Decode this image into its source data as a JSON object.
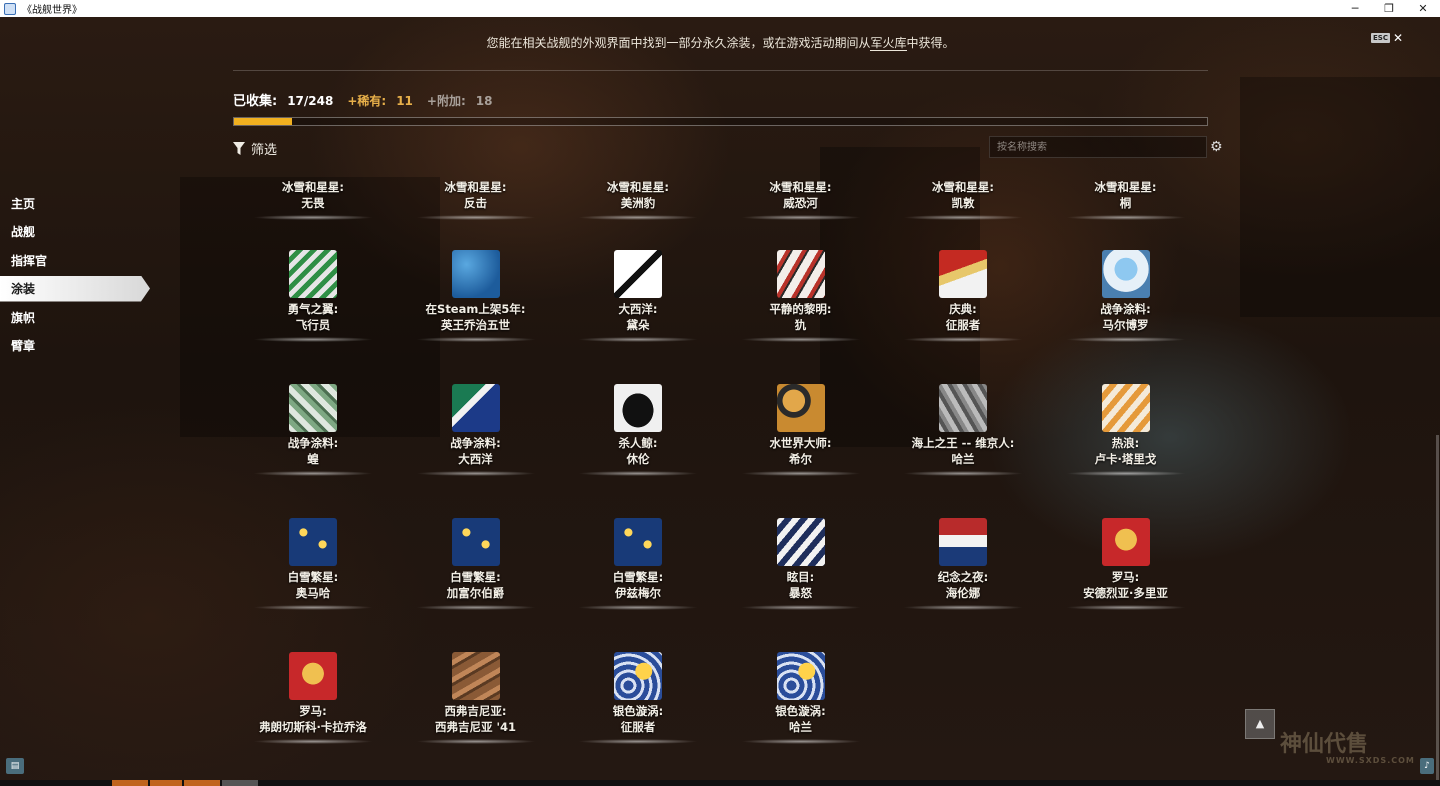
{
  "window": {
    "title": "《战舰世界》",
    "controls": [
      "─",
      "❐",
      "✕"
    ]
  },
  "notice": {
    "before": "您能在相关战舰的外观界面中找到一部分永久涂装，或在游戏活动期间从",
    "link": "军火库",
    "after": "中获得。"
  },
  "esc": {
    "key": "ESC",
    "close": "✕"
  },
  "stats": {
    "collected_label": "已收集:",
    "collected_value": "17/248",
    "rare_label": "+稀有:",
    "rare_value": "11",
    "extra_label": "+附加:",
    "extra_value": "18",
    "progress_fraction": 0.06
  },
  "filter": {
    "label": "筛选"
  },
  "search": {
    "placeholder": "按名称搜索"
  },
  "sidebar": {
    "items": [
      {
        "label": "主页",
        "active": false
      },
      {
        "label": "战舰",
        "active": false
      },
      {
        "label": "指挥官",
        "active": false
      },
      {
        "label": "涂装",
        "active": true
      },
      {
        "label": "旗帜",
        "active": false
      },
      {
        "label": "臂章",
        "active": false
      }
    ]
  },
  "cards": [
    {
      "line1": "冰雪和星星:",
      "line2": "无畏",
      "icon": "none"
    },
    {
      "line1": "冰雪和星星:",
      "line2": "反击",
      "icon": "none"
    },
    {
      "line1": "冰雪和星星:",
      "line2": "美洲豹",
      "icon": "none"
    },
    {
      "line1": "冰雪和星星:",
      "line2": "威恐河",
      "icon": "none"
    },
    {
      "line1": "冰雪和星星:",
      "line2": "凯敦",
      "icon": "none"
    },
    {
      "line1": "冰雪和星星:",
      "line2": "桐",
      "icon": "none"
    },
    {
      "line1": "勇气之翼:",
      "line2": "飞行员",
      "icon": "green-white-stripes-icon"
    },
    {
      "line1": "在Steam上架5年:",
      "line2": "英王乔治五世",
      "icon": "blue-pattern-icon"
    },
    {
      "line1": "大西洋:",
      "line2": "黛朵",
      "icon": "black-white-wing-icon"
    },
    {
      "line1": "平静的黎明:",
      "line2": "犰",
      "icon": "red-white-diagonal-icon"
    },
    {
      "line1": "庆典:",
      "line2": "征服者",
      "icon": "red-gold-icon"
    },
    {
      "line1": "战争涂料:",
      "line2": "马尔博罗",
      "icon": "blue-medal-icon"
    },
    {
      "line1": "战争涂料:",
      "line2": "蝗",
      "icon": "green-camo-icon"
    },
    {
      "line1": "战争涂料:",
      "line2": "大西洋",
      "icon": "blue-green-camo-icon"
    },
    {
      "line1": "杀人鲸:",
      "line2": "休伦",
      "icon": "orca-icon"
    },
    {
      "line1": "水世界大师:",
      "line2": "希尔",
      "icon": "amber-camo-icon"
    },
    {
      "line1": "海上之王 -- 维京人:",
      "line2": "哈兰",
      "icon": "gray-viking-icon"
    },
    {
      "line1": "热浪:",
      "line2": "卢卡·塔里戈",
      "icon": "orange-white-icon"
    },
    {
      "line1": "白雪繁星:",
      "line2": "奥马哈",
      "icon": "navy-star-icon"
    },
    {
      "line1": "白雪繁星:",
      "line2": "加富尔伯爵",
      "icon": "navy-star-icon"
    },
    {
      "line1": "白雪繁星:",
      "line2": "伊兹梅尔",
      "icon": "navy-star-icon"
    },
    {
      "line1": "眩目:",
      "line2": "暴怒",
      "icon": "dazzle-stripes-icon"
    },
    {
      "line1": "纪念之夜:",
      "line2": "海伦娜",
      "icon": "red-blue-white-icon"
    },
    {
      "line1": "罗马:",
      "line2": "安德烈亚·多里亚",
      "icon": "roman-red-gold-icon"
    },
    {
      "line1": "罗马:",
      "line2": "弗朗切斯科·卡拉乔洛",
      "icon": "roman-red-gold-icon"
    },
    {
      "line1": "西弗吉尼亚:",
      "line2": "西弗吉尼亚 '41",
      "icon": "brown-camo-icon"
    },
    {
      "line1": "银色漩涡:",
      "line2": "征服者",
      "icon": "swirl-sun-icon"
    },
    {
      "line1": "银色漩涡:",
      "line2": "哈兰",
      "icon": "swirl-sun-icon"
    }
  ],
  "scroll_top": {
    "label": "▲"
  },
  "watermark": {
    "text": "神仙代售",
    "url": "WWW.SXDS.COM"
  },
  "colors": {
    "accent": "#f0b020",
    "rare": "#e8b04a",
    "extra": "#a8a09a"
  }
}
